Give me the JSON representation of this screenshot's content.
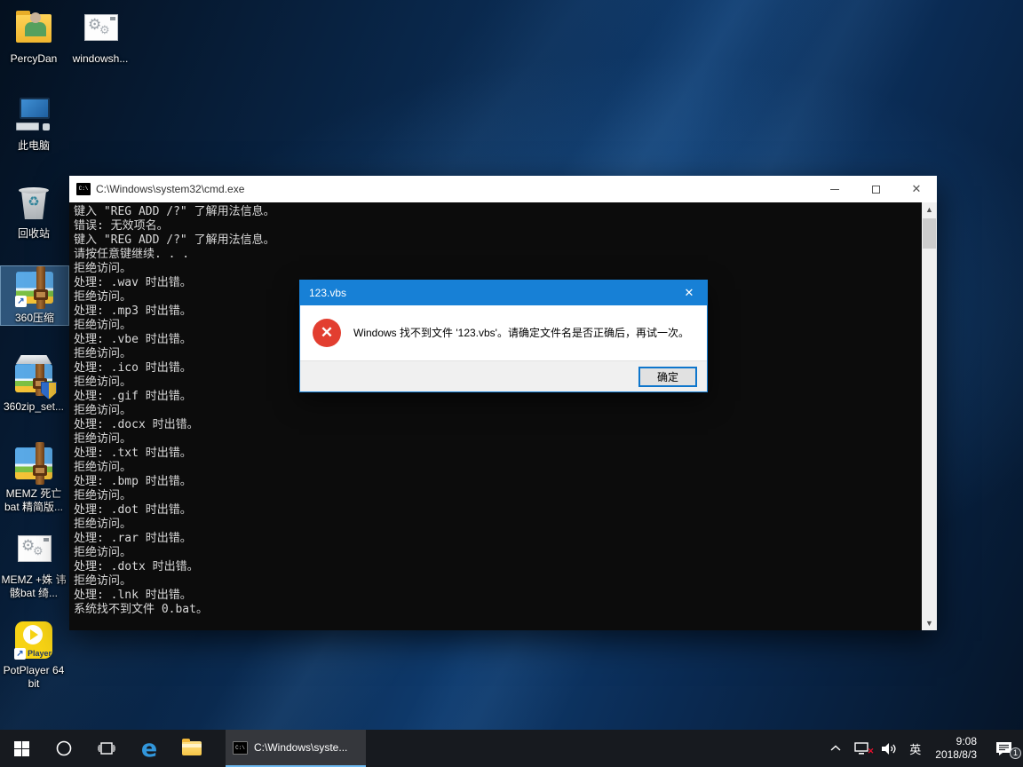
{
  "desktop": {
    "icons": [
      {
        "label": "PercyDan"
      },
      {
        "label": "windowsh..."
      },
      {
        "label": "此电脑"
      },
      {
        "label": "回收站"
      },
      {
        "label": "360压缩"
      },
      {
        "label": "360zip_set..."
      },
      {
        "label": "MEMZ 死亡 bat 精简版..."
      },
      {
        "label": "MEMZ +姝 讳骸bat 绮..."
      },
      {
        "label": "PotPlayer 64 bit"
      }
    ],
    "shortcut_arrow_glyph": "↗"
  },
  "cmd_window": {
    "title": "C:\\Windows\\system32\\cmd.exe",
    "app_icon_text": "C:\\",
    "close_glyph": "✕",
    "scroll_up_glyph": "▲",
    "scroll_down_glyph": "▼",
    "lines": [
      "键入 \"REG ADD /?\" 了解用法信息。",
      "错误: 无效项名。",
      "键入 \"REG ADD /?\" 了解用法信息。",
      "请按任意键继续. . .",
      "拒绝访问。",
      "处理: .wav 时出错。",
      "拒绝访问。",
      "处理: .mp3 时出错。",
      "拒绝访问。",
      "处理: .vbe 时出错。",
      "拒绝访问。",
      "处理: .ico 时出错。",
      "拒绝访问。",
      "处理: .gif 时出错。",
      "拒绝访问。",
      "处理: .docx 时出错。",
      "拒绝访问。",
      "处理: .txt 时出错。",
      "拒绝访问。",
      "处理: .bmp 时出错。",
      "拒绝访问。",
      "处理: .dot 时出错。",
      "拒绝访问。",
      "处理: .rar 时出错。",
      "拒绝访问。",
      "处理: .dotx 时出错。",
      "拒绝访问。",
      "处理: .lnk 时出错。",
      "系统找不到文件 0.bat。"
    ]
  },
  "dialog": {
    "title": "123.vbs",
    "close_glyph": "✕",
    "error_icon_glyph": "✕",
    "message": "Windows 找不到文件 '123.vbs'。请确定文件名是否正确后，再试一次。",
    "ok_label": "确定"
  },
  "taskbar": {
    "cmd_button_label": "C:\\Windows\\syste...",
    "cmd_button_icon_text": "C:\\",
    "ime_indicator": "英",
    "network_error_glyph": "✕",
    "clock": {
      "time": "9:08",
      "date": "2018/8/3"
    },
    "notification_badge": "1"
  },
  "colors": {
    "dialog_titlebar": "#1780d6",
    "error_red": "#e23e30",
    "taskbar_bg": "#171a1f",
    "active_task_underline": "#6cb8f0",
    "accent_blue": "#0e76cc"
  }
}
